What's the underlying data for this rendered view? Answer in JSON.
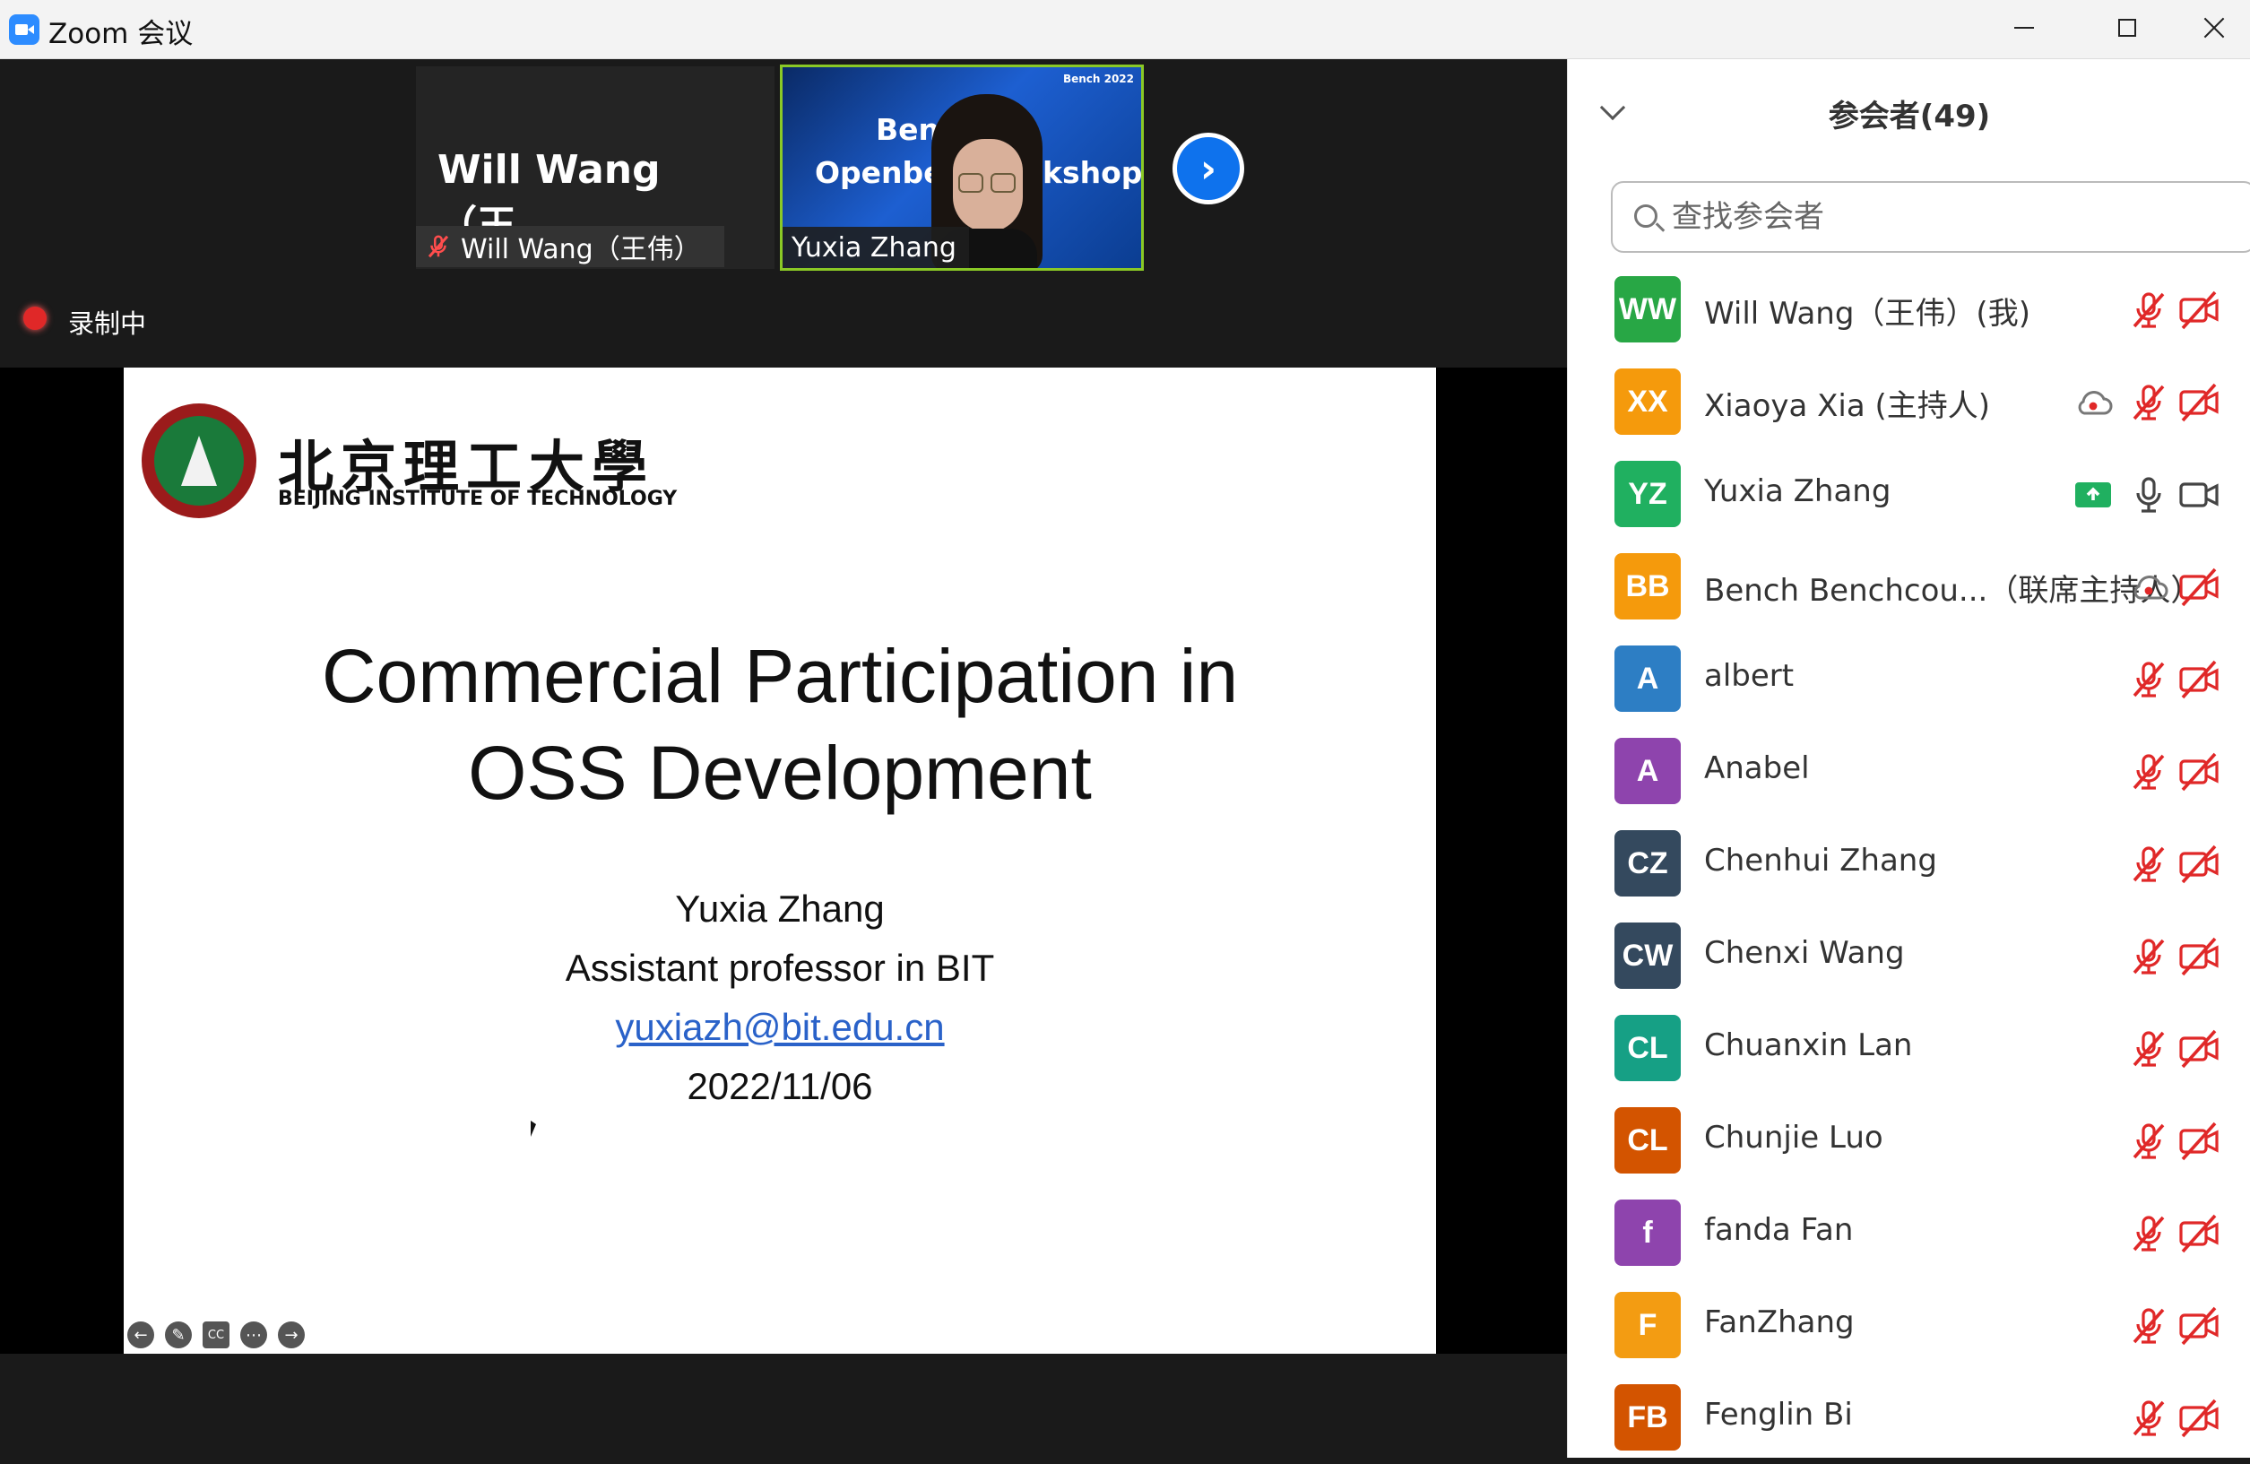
{
  "window": {
    "title": "Zoom 会议"
  },
  "video_strip": {
    "will": {
      "display_name": "Will Wang（王...",
      "label": "Will Wang（王伟）"
    },
    "yuxia": {
      "label": "Yuxia Zhang",
      "background_texts": [
        "Benc",
        "Openber",
        "kshop",
        "Bench 2022"
      ]
    },
    "next_label": "›"
  },
  "recording": {
    "label": "录制中"
  },
  "slide": {
    "university_cn": "北京理工大學",
    "university_en": "BEIJING INSTITUTE OF TECHNOLOGY",
    "title_line1": "Commercial Participation in",
    "title_line2": "OSS Development",
    "author": "Yuxia Zhang",
    "position": "Assistant professor in BIT",
    "email": "yuxiazh@bit.edu.cn",
    "date": "2022/11/06"
  },
  "participants_panel": {
    "title": "参会者(49)",
    "search_placeholder": "查找参会者",
    "participants": [
      {
        "initials": "WW",
        "name": "Will Wang（王伟）(我)",
        "color": "#28a745",
        "mic": "muted",
        "video": "off"
      },
      {
        "initials": "XX",
        "name": "Xiaoya Xia (主持人)",
        "color": "#f59a0c",
        "mic": "muted",
        "video": "off",
        "extra": "cloud-recording-icon"
      },
      {
        "initials": "YZ",
        "name": "Yuxia Zhang",
        "color": "#20b060",
        "mic": "on",
        "video": "on",
        "extra": "share-screen-icon"
      },
      {
        "initials": "BB",
        "name": "Bench Benchcou...（联席主持人）",
        "color": "#f59a0c",
        "mic": "cloud",
        "video": "off"
      },
      {
        "initials": "A",
        "name": "albert",
        "color": "#2d7ec4",
        "mic": "muted",
        "video": "off"
      },
      {
        "initials": "A",
        "name": "Anabel",
        "color": "#8e44ad",
        "mic": "muted",
        "video": "off"
      },
      {
        "initials": "CZ",
        "name": "Chenhui Zhang",
        "color": "#34495e",
        "mic": "muted",
        "video": "off"
      },
      {
        "initials": "CW",
        "name": "Chenxi Wang",
        "color": "#34495e",
        "mic": "muted",
        "video": "off"
      },
      {
        "initials": "CL",
        "name": "Chuanxin Lan",
        "color": "#16a085",
        "mic": "muted",
        "video": "off"
      },
      {
        "initials": "CL",
        "name": "Chunjie Luo",
        "color": "#d35400",
        "mic": "muted",
        "video": "off"
      },
      {
        "initials": "f",
        "name": "fanda Fan",
        "color": "#8e44ad",
        "mic": "muted",
        "video": "off"
      },
      {
        "initials": "F",
        "name": "FanZhang",
        "color": "#f39c12",
        "mic": "muted",
        "video": "off"
      },
      {
        "initials": "FB",
        "name": "Fenglin Bi",
        "color": "#d35400",
        "mic": "muted",
        "video": "off"
      }
    ]
  }
}
